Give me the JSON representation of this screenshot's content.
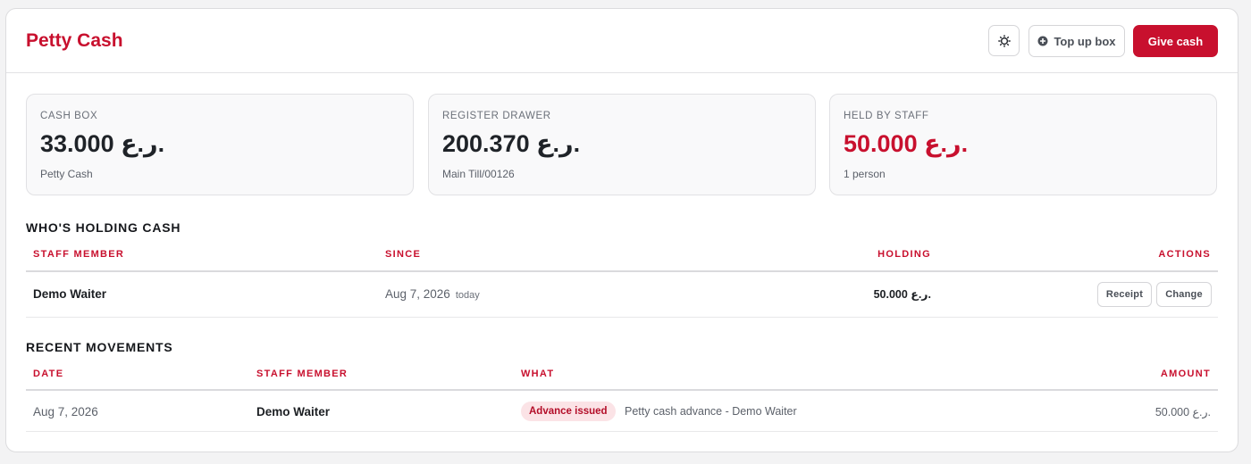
{
  "header": {
    "title": "Petty Cash",
    "topup_label": "Top up box",
    "give_label": "Give cash"
  },
  "stats": [
    {
      "label": "CASH BOX",
      "value": "33.000 ر.ع.",
      "sub": "Petty Cash"
    },
    {
      "label": "REGISTER DRAWER",
      "value": "200.370 ر.ع.",
      "sub": "Main Till/00126"
    },
    {
      "label": "HELD BY STAFF",
      "value": "50.000 ر.ع.",
      "sub": "1 person"
    }
  ],
  "holding": {
    "title": "WHO'S HOLDING CASH",
    "columns": {
      "staff": "STAFF MEMBER",
      "since": "SINCE",
      "holding": "HOLDING",
      "actions": "ACTIONS"
    },
    "rows": [
      {
        "staff": "Demo Waiter",
        "since": "Aug 7, 2026",
        "since_note": "today",
        "holding": "50.000 ر.ع.",
        "receipt_label": "Receipt",
        "change_label": "Change"
      }
    ]
  },
  "movements": {
    "title": "RECENT MOVEMENTS",
    "columns": {
      "date": "DATE",
      "staff": "STAFF MEMBER",
      "what": "WHAT",
      "amount": "AMOUNT"
    },
    "rows": [
      {
        "date": "Aug 7, 2026",
        "staff": "Demo Waiter",
        "badge": "Advance issued",
        "description": "Petty cash advance - Demo Waiter",
        "amount": "50.000 ر.ع."
      }
    ]
  },
  "colors": {
    "accent": "#c8102e",
    "badge_bg": "#fbe3e6"
  },
  "icons": {
    "theme": "sun-icon",
    "topup": "plus-circle-icon"
  }
}
